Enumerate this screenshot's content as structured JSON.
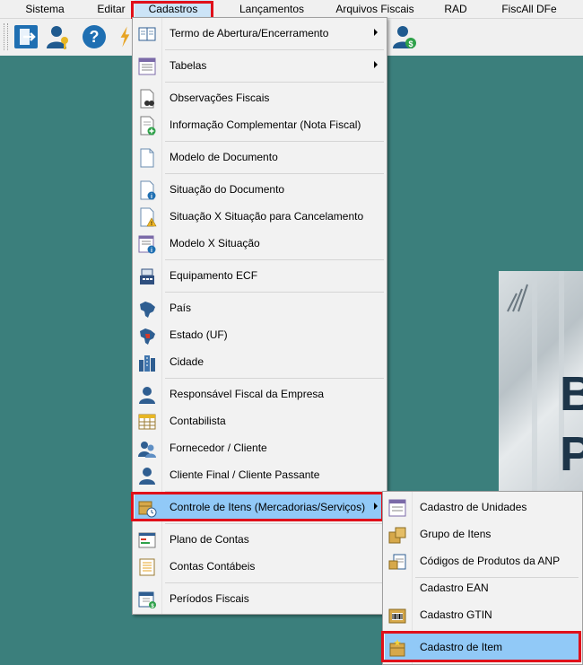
{
  "menubar": {
    "items": [
      "Sistema",
      "Editar",
      "Cadastros",
      "Lançamentos",
      "Arquivos Fiscais",
      "RAD",
      "FiscAll DFe"
    ]
  },
  "cadastros_menu": {
    "items": [
      {
        "label": "Termo de Abertura/Encerramento",
        "icon": "book-icon",
        "submenu": true
      },
      {
        "label": "Tabelas",
        "icon": "table-icon",
        "submenu": true
      },
      {
        "label": "Observações Fiscais",
        "icon": "document-binoculars-icon"
      },
      {
        "label": "Informação Complementar (Nota Fiscal)",
        "icon": "document-add-icon"
      },
      {
        "label": "Modelo de Documento",
        "icon": "blank-document-icon"
      },
      {
        "label": "Situação do Documento",
        "icon": "document-info-icon"
      },
      {
        "label": "Situação X Situação para Cancelamento",
        "icon": "document-warning-icon"
      },
      {
        "label": "Modelo X Situação",
        "icon": "document-list-info-icon"
      },
      {
        "label": "Equipamento ECF",
        "icon": "cash-register-icon"
      },
      {
        "label": "País",
        "icon": "brazil-map-icon"
      },
      {
        "label": "Estado (UF)",
        "icon": "brazil-state-map-icon"
      },
      {
        "label": "Cidade",
        "icon": "city-buildings-icon"
      },
      {
        "label": "Responsável Fiscal da Empresa",
        "icon": "user-icon"
      },
      {
        "label": "Contabilista",
        "icon": "spreadsheet-icon"
      },
      {
        "label": "Fornecedor / Cliente",
        "icon": "users-icon"
      },
      {
        "label": "Cliente Final / Cliente Passante",
        "icon": "user-icon"
      },
      {
        "label": "Controle de Itens (Mercadorias/Serviços)",
        "icon": "items-control-icon",
        "submenu": true
      },
      {
        "label": "Plano de Contas",
        "icon": "chart-of-accounts-icon"
      },
      {
        "label": "Contas Contábeis",
        "icon": "accounting-ledger-icon"
      },
      {
        "label": "Períodos Fiscais",
        "icon": "calendar-money-icon"
      }
    ]
  },
  "itens_submenu": {
    "items": [
      {
        "label": "Cadastro de Unidades",
        "icon": "units-list-icon"
      },
      {
        "label": "Grupo de Itens",
        "icon": "boxes-icon"
      },
      {
        "label": "Códigos de Produtos da ANP",
        "icon": "anp-products-icon"
      },
      {
        "label": "Cadastro EAN",
        "icon": ""
      },
      {
        "label": "Cadastro GTIN",
        "icon": "barcode-box-icon"
      },
      {
        "label": "Cadastro de Item",
        "icon": "item-box-icon"
      }
    ]
  },
  "colors": {
    "highlight": "#91c9f7",
    "annotation": "#e0101a",
    "desktop": "#3b7f7c"
  }
}
